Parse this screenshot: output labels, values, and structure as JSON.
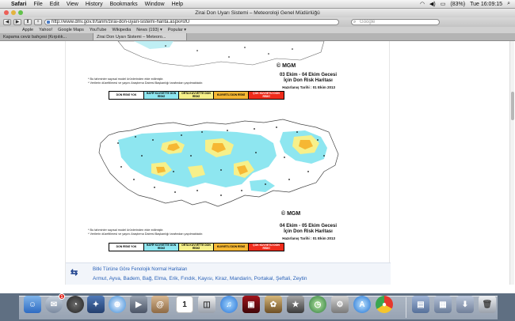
{
  "menubar": {
    "apple_glyph": "",
    "app_name": "Safari",
    "items": [
      "File",
      "Edit",
      "View",
      "History",
      "Bookmarks",
      "Window",
      "Help"
    ],
    "battery": "(83%)",
    "clock": "Tue 16:09:15"
  },
  "browser": {
    "window_title": "Zirai Don Uyarı Sistemi – Meteoroloji Genel Müdürlüğü",
    "url": "http://www.dmi.gov.tr/tarim/zirai-don-uyari-sistemi-harita.aspx#sfU",
    "search_placeholder": "Google",
    "bookmarks": [
      "Apple",
      "Yahoo!",
      "Google Maps",
      "YouTube",
      "Wikipedia",
      "News (193) ▾",
      "Popular ▾"
    ],
    "tabs": [
      {
        "label": "Kapama ceviz bahçesi (Kırpılık..."
      },
      {
        "label": "Zirai Don Uyarı Sistemi – Meteoro..."
      }
    ]
  },
  "maps": [
    {
      "title_line1": "03 Ekim - 04 Ekim Gecesi",
      "title_line2": "İçin Don Risk Haritası",
      "date": "Hazırlanış Tarihi : 01 Ekim 2013",
      "logo": "© MGM"
    },
    {
      "title_line1": "04 Ekim - 05 Ekim Gecesi",
      "title_line2": "İçin Don Risk Haritası",
      "date": "Hazırlanış Tarihi : 01 Ekim 2013",
      "logo": "© MGM"
    }
  ],
  "notes": {
    "line1": "* Bu tahminler sayısal model ürünlerinden elde edilmiştir.",
    "line2": "* Verilerin düzeltilmesi ve yayını Araştırma Dairesi Başkanlığı tarafından yapılmaktadır."
  },
  "legend": [
    {
      "label": "DON RİSKİ YOK",
      "color": "#ffffff"
    },
    {
      "label": "HAFİF KUVVETTE DON RİSKİ",
      "color": "#8ee6f0"
    },
    {
      "label": "ORTA KUVVETTE DON RİSKİ",
      "color": "#f6f08a"
    },
    {
      "label": "KUVVETLİ DON RİSKİ",
      "color": "#f6b733"
    },
    {
      "label": "ÇOK KUVVETLİ DON RİSKİ",
      "color": "#ef2b1b"
    }
  ],
  "phenology": {
    "title": "Bitki Türüne Göre Fenolojik Normal Haritaları",
    "crops": "Armut, Ayva, Badem, Bağ, Elma, Erik, Fındık, Kayısı, Kiraz, Mandarin, Portakal, Şeftali, Zeytin"
  },
  "dock": {
    "mail_badge": "1",
    "calendar_day": "1"
  }
}
